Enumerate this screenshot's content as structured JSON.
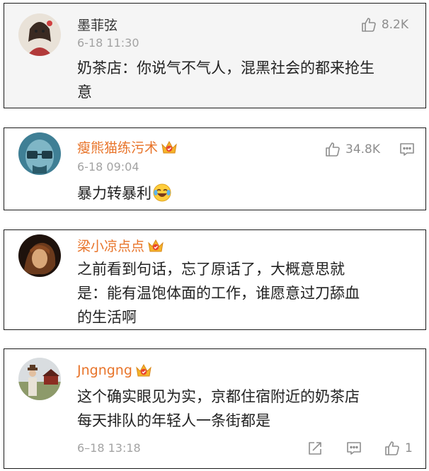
{
  "comments": [
    {
      "username": "墨菲弦",
      "time": "6-18 11:30",
      "likes": "8.2K",
      "lines": [
        "奶茶店：你说气不气人，混黑社会的都来抢生",
        "意"
      ]
    },
    {
      "username": "瘦熊猫练污术",
      "time": "6-18 09:04",
      "likes": "34.8K",
      "lines": [
        "暴力转暴利"
      ],
      "emoji": "laughing-crying-emoji"
    },
    {
      "username": "梁小凉点点",
      "lines": [
        "之前看到句话，忘了原话了，大概意思就",
        "是：能有温饱体面的工作，谁愿意过刀舔血",
        "的生活啊"
      ]
    },
    {
      "username": "Jngngng",
      "time": "6–18 13:18",
      "likes": "1",
      "lines": [
        "这个确实眼见为实，京都住宿附近的奶茶店",
        "每天排队的年轻人一条街都是"
      ]
    }
  ],
  "colors": {
    "vip_name": "#e8742a",
    "text": "#222222",
    "meta": "#a3a3a3",
    "icon": "#8e8e8e"
  }
}
